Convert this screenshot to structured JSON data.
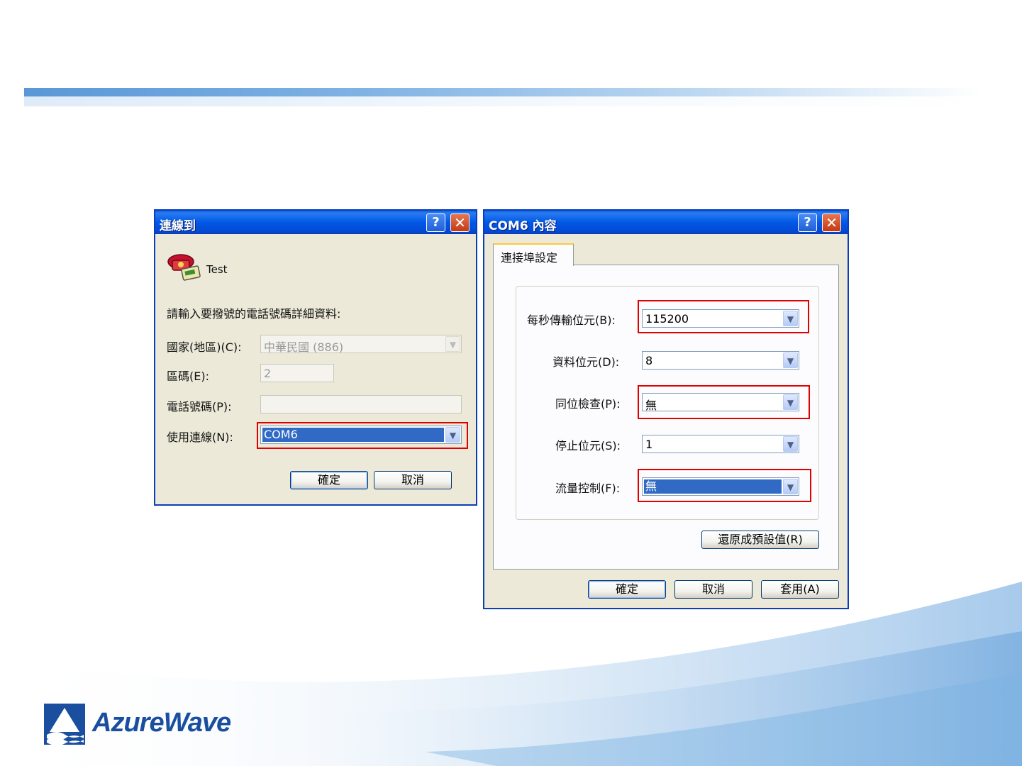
{
  "connect_dialog": {
    "title": "連線到",
    "connection_name": "Test",
    "instruction": "請輸入要撥號的電話號碼詳細資料:",
    "country_label": "國家(地區)(C):",
    "country_value": "中華民國 (886)",
    "area_code_label": "區碼(E):",
    "area_code_value": "2",
    "phone_label": "電話號碼(P):",
    "phone_value": "",
    "connect_using_label": "使用連線(N):",
    "connect_using_value": "COM6",
    "ok_label": "確定",
    "cancel_label": "取消"
  },
  "com_dialog": {
    "title": "COM6 內容",
    "tab_label": "連接埠設定",
    "baud_label": "每秒傳輸位元(B):",
    "baud_value": "115200",
    "data_bits_label": "資料位元(D):",
    "data_bits_value": "8",
    "parity_label": "同位檢查(P):",
    "parity_value": "無",
    "stop_bits_label": "停止位元(S):",
    "stop_bits_value": "1",
    "flow_label": "流量控制(F):",
    "flow_value": "無",
    "restore_label": "還原成預設值(R)",
    "ok_label": "確定",
    "cancel_label": "取消",
    "apply_label": "套用(A)"
  },
  "titlebar": {
    "help_glyph": "?",
    "close_glyph": "✕"
  },
  "brand": {
    "name": "AzureWave"
  },
  "colors": {
    "highlight": "#e00000",
    "selection": "#316ac5",
    "titlebar": "#0058e6"
  }
}
